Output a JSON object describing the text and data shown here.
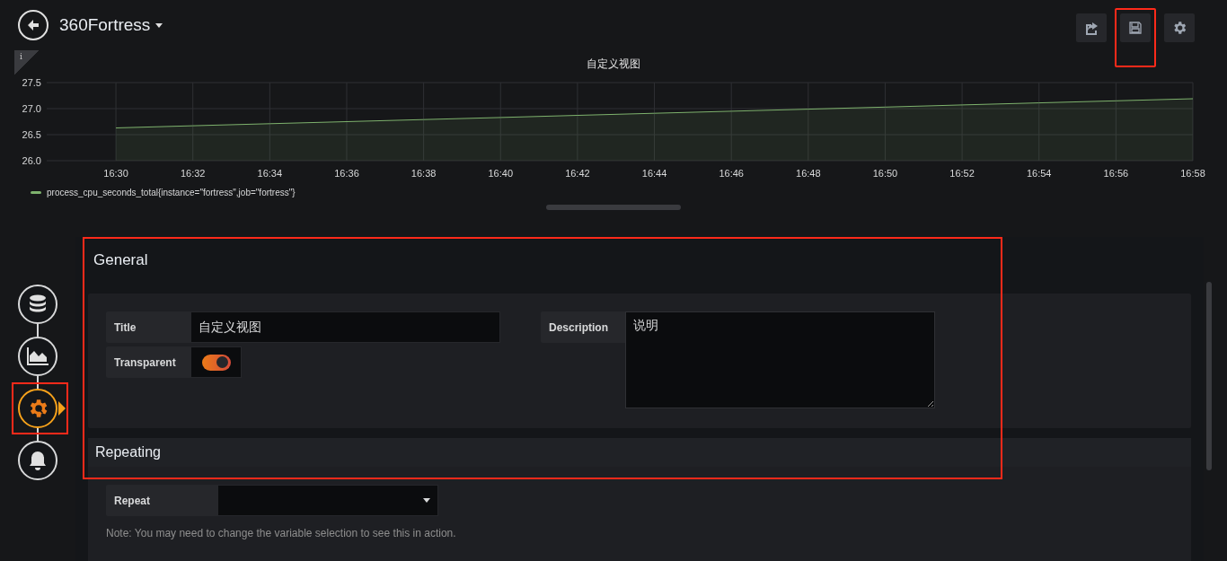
{
  "dashboard": {
    "title": "360Fortress"
  },
  "toolbar": [
    {
      "kind": "share",
      "highlighted": false
    },
    {
      "kind": "save",
      "highlighted": true
    },
    {
      "kind": "settings",
      "highlighted": false
    }
  ],
  "panel": {
    "info": "i",
    "chart_data": {
      "type": "area",
      "title": "自定义视图",
      "grid": true,
      "categories": [
        "16:30",
        "16:32",
        "16:34",
        "16:36",
        "16:38",
        "16:40",
        "16:42",
        "16:44",
        "16:46",
        "16:48",
        "16:50",
        "16:52",
        "16:54",
        "16:56",
        "16:58"
      ],
      "series": [
        {
          "name": "process_cpu_seconds_total{instance=\"fortress\",job=\"fortress\"}",
          "color": "#7eb26d",
          "values": [
            26.63,
            26.67,
            26.71,
            26.75,
            26.79,
            26.83,
            26.87,
            26.91,
            26.95,
            26.99,
            27.03,
            27.07,
            27.11,
            27.15,
            27.19
          ]
        }
      ],
      "ylim": [
        26.0,
        27.5
      ],
      "yticks": [
        {
          "value": 26.0,
          "label": "26.0"
        },
        {
          "value": 26.5,
          "label": "26.5"
        },
        {
          "value": 27.0,
          "label": "27.0"
        },
        {
          "value": 27.5,
          "label": "27.5"
        }
      ]
    }
  },
  "steps": [
    {
      "kind": "queries",
      "selected": false,
      "highlighted": false
    },
    {
      "kind": "visualization",
      "selected": false,
      "highlighted": false
    },
    {
      "kind": "general",
      "selected": true,
      "highlighted": true
    },
    {
      "kind": "alert",
      "selected": false,
      "highlighted": false
    }
  ],
  "general": {
    "heading": "General",
    "highlighted": true,
    "title": {
      "label": "Title",
      "value": "自定义视图"
    },
    "transparent": {
      "label": "Transparent",
      "on": true
    },
    "description": {
      "label": "Description",
      "value": "说明"
    }
  },
  "repeating": {
    "heading": "Repeating",
    "repeat": {
      "label": "Repeat"
    },
    "note": "Note: You may need to change the variable selection to see this in action."
  }
}
